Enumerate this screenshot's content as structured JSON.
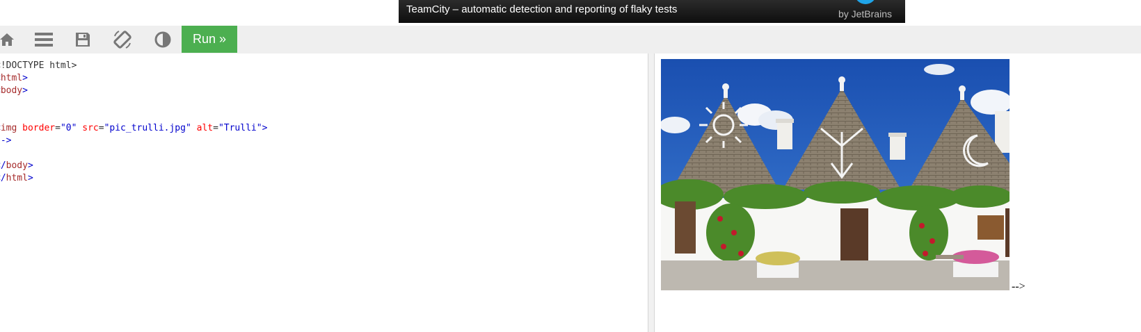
{
  "ad": {
    "text": "TeamCity – automatic detection and reporting of flaky tests",
    "brand": "by JetBrains"
  },
  "toolbar": {
    "icons": [
      "home-icon",
      "menu-icon",
      "save-icon",
      "rotate-icon",
      "contrast-icon"
    ],
    "run_label": "Run »"
  },
  "editor": {
    "lines": [
      [
        {
          "t": "plain",
          "v": "<!DOCTYPE html>"
        }
      ],
      [
        {
          "t": "br",
          "v": "<"
        },
        {
          "t": "tag",
          "v": "html"
        },
        {
          "t": "br",
          "v": ">"
        }
      ],
      [
        {
          "t": "br",
          "v": "<"
        },
        {
          "t": "tag",
          "v": "body"
        },
        {
          "t": "br",
          "v": ">"
        }
      ],
      [],
      [],
      [
        {
          "t": "br",
          "v": "<"
        },
        {
          "t": "tag",
          "v": "img"
        },
        {
          "t": "plain",
          "v": " "
        },
        {
          "t": "attr",
          "v": "border"
        },
        {
          "t": "plain",
          "v": "="
        },
        {
          "t": "val",
          "v": "\"0\""
        },
        {
          "t": "plain",
          "v": " "
        },
        {
          "t": "attr",
          "v": "src"
        },
        {
          "t": "plain",
          "v": "="
        },
        {
          "t": "val",
          "v": "\"pic_trulli.jpg\""
        },
        {
          "t": "plain",
          "v": " "
        },
        {
          "t": "attr",
          "v": "alt"
        },
        {
          "t": "plain",
          "v": "="
        },
        {
          "t": "val",
          "v": "\"Trulli\""
        },
        {
          "t": "br",
          "v": ">"
        }
      ],
      [
        {
          "t": "br",
          "v": "-->"
        }
      ],
      [],
      [
        {
          "t": "br",
          "v": "</"
        },
        {
          "t": "tag",
          "v": "body"
        },
        {
          "t": "br",
          "v": ">"
        }
      ],
      [
        {
          "t": "br",
          "v": "</"
        },
        {
          "t": "tag",
          "v": "html"
        },
        {
          "t": "br",
          "v": ">"
        }
      ]
    ]
  },
  "result": {
    "image_alt": "Trulli",
    "trailing_text": "-->"
  },
  "colors": {
    "run": "#4caf50",
    "toolbar_bg": "#efefef",
    "tag": "#a52a2a",
    "bracket": "#0000cd",
    "attribute": "#ff0000",
    "value": "#0000cd"
  }
}
